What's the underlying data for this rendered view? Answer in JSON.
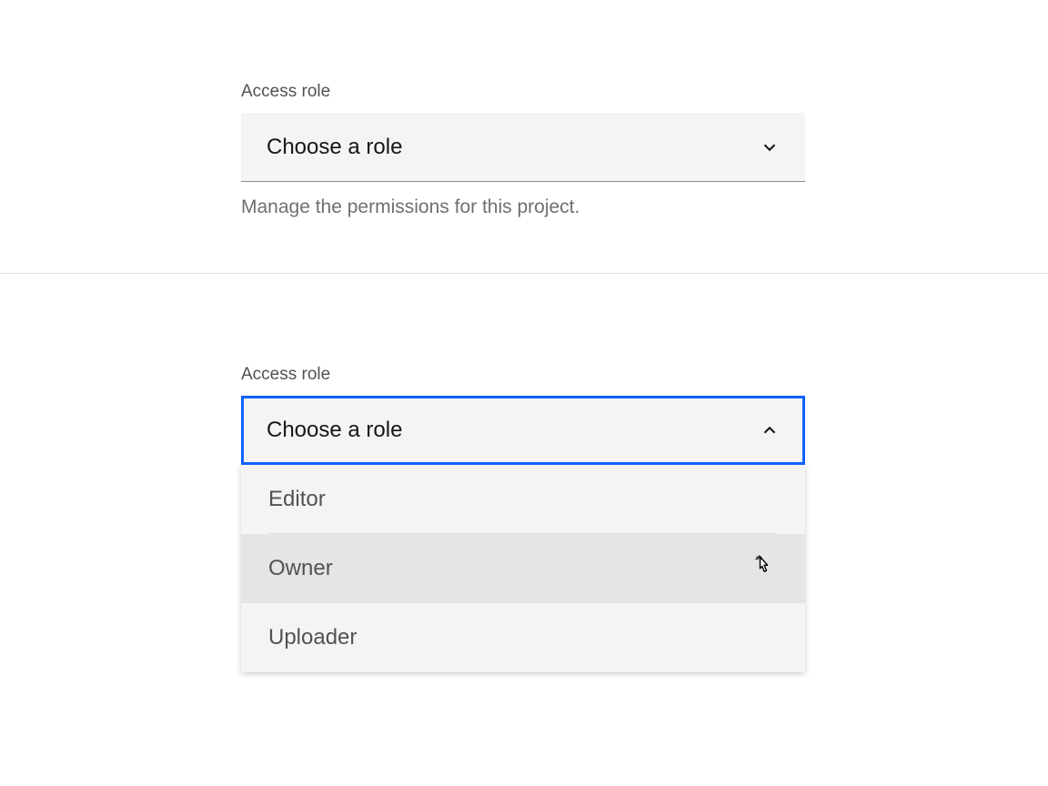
{
  "closed_state": {
    "label": "Access role",
    "placeholder": "Choose a role",
    "help_text": "Manage the permissions for this project."
  },
  "open_state": {
    "label": "Access role",
    "placeholder": "Choose a role",
    "options": [
      {
        "label": "Editor"
      },
      {
        "label": "Owner"
      },
      {
        "label": "Uploader"
      }
    ]
  }
}
